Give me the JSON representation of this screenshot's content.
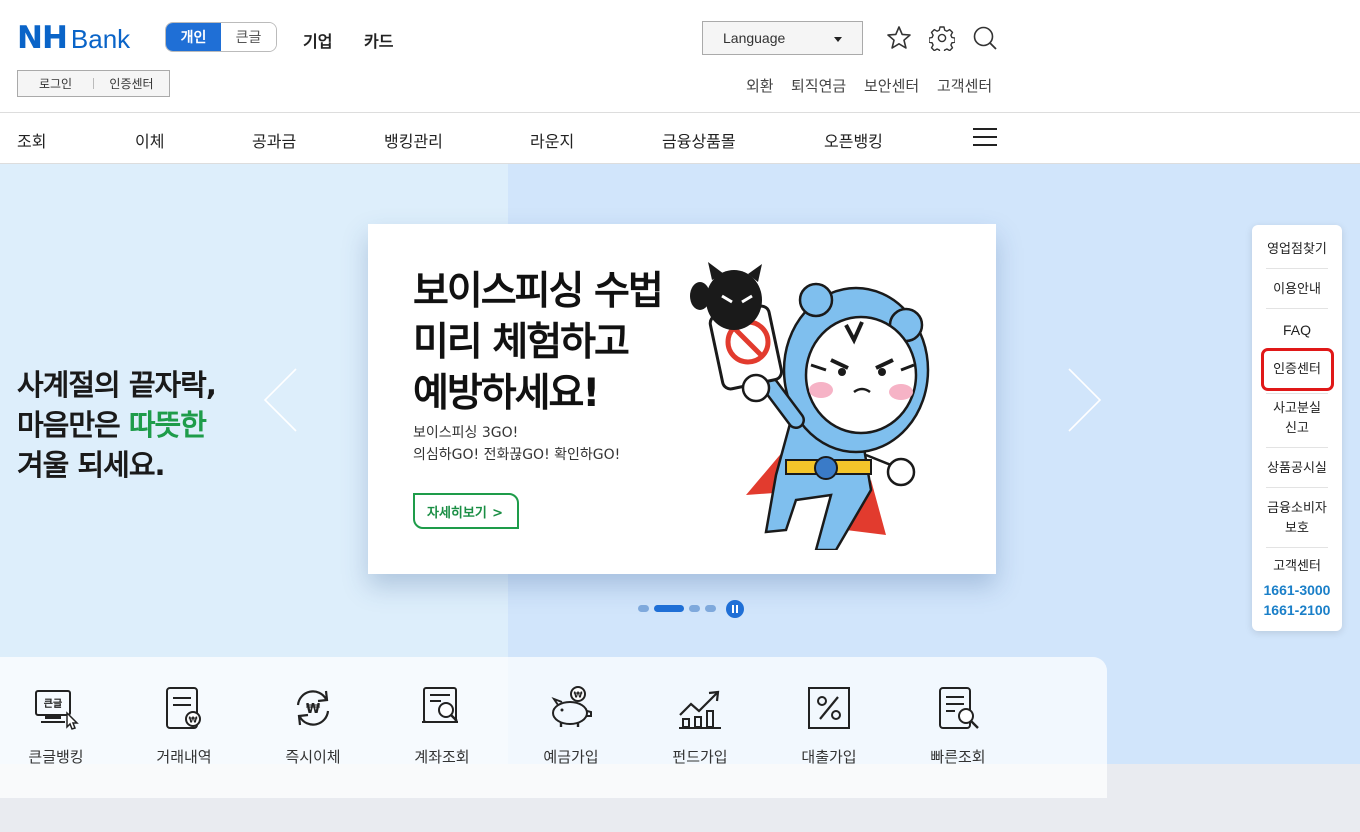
{
  "header": {
    "logo_nh": "NH",
    "logo_bank": "Bank",
    "segment": {
      "personal": "개인",
      "large_font": "큰글"
    },
    "top_menu": [
      "기업",
      "카드"
    ],
    "login": "로그인",
    "cert_center": "인증센터",
    "language": "Language",
    "util_links": [
      "외환",
      "퇴직연금",
      "보안센터",
      "고객센터"
    ]
  },
  "nav": {
    "items": [
      "조회",
      "이체",
      "공과금",
      "뱅킹관리",
      "라운지",
      "금융상품몰",
      "오픈뱅킹"
    ]
  },
  "hero": {
    "slogan_line1": "사계절의 끝자락,",
    "slogan_line2a": "마음만은 ",
    "slogan_line2b": "따뜻한",
    "slogan_line3": "겨울 되세요.",
    "card": {
      "title_line1": "보이스피싱 수법",
      "title_line2": "미리 체험하고",
      "title_line3": "예방하세요!",
      "sub_line1": "보이스피싱 3GO!",
      "sub_line2": "의심하GO! 전화끊GO! 확인하GO!",
      "button": "자세히보기",
      "button_chevron": ">"
    },
    "slides_total": 4,
    "slide_active": 2
  },
  "side_menu": {
    "items": [
      "영업점찾기",
      "이용안내",
      "FAQ",
      "인증센터",
      "사고분실",
      "신고",
      "상품공시실",
      "금융소비자",
      "보호",
      "고객센터"
    ],
    "phone1": "1661-3000",
    "phone2": "1661-2100",
    "highlighted": "인증센터"
  },
  "quick": {
    "items": [
      "큰글뱅킹",
      "거래내역",
      "즉시이체",
      "계좌조회",
      "예금가입",
      "펀드가입",
      "대출가입",
      "빠른조회"
    ],
    "big_icon_text": "큰글"
  },
  "colors": {
    "brand_blue": "#0a64c8",
    "accent_green": "#1e9c4a",
    "highlight_red": "#e01818"
  }
}
